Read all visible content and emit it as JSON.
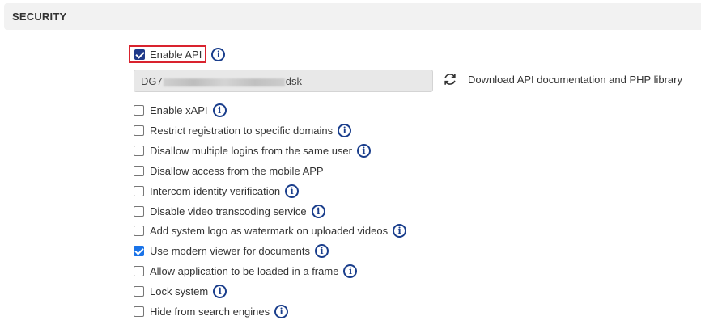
{
  "section": {
    "title": "SECURITY"
  },
  "api": {
    "enable_label": "Enable API",
    "enabled": true,
    "key_prefix": "DG7",
    "key_suffix": "dsk",
    "download_label": "Download API documentation and PHP library"
  },
  "options": [
    {
      "label": "Enable xAPI",
      "checked": false,
      "info": true
    },
    {
      "label": "Restrict registration to specific domains",
      "checked": false,
      "info": true
    },
    {
      "label": "Disallow multiple logins from the same user",
      "checked": false,
      "info": true
    },
    {
      "label": "Disallow access from the mobile APP",
      "checked": false,
      "info": false
    },
    {
      "label": "Intercom identity verification",
      "checked": false,
      "info": true
    },
    {
      "label": "Disable video transcoding service",
      "checked": false,
      "info": true
    },
    {
      "label": "Add system logo as watermark on uploaded videos",
      "checked": false,
      "info": true
    },
    {
      "label": "Use modern viewer for documents",
      "checked": true,
      "info": true
    },
    {
      "label": "Allow application to be loaded in a frame",
      "checked": false,
      "info": true
    },
    {
      "label": "Lock system",
      "checked": false,
      "info": true
    },
    {
      "label": "Hide from search engines",
      "checked": false,
      "info": true
    }
  ],
  "colors": {
    "highlight": "#d9232e",
    "info_icon": "#1a3e8c",
    "checkbox_checked": "#1a73e8"
  }
}
